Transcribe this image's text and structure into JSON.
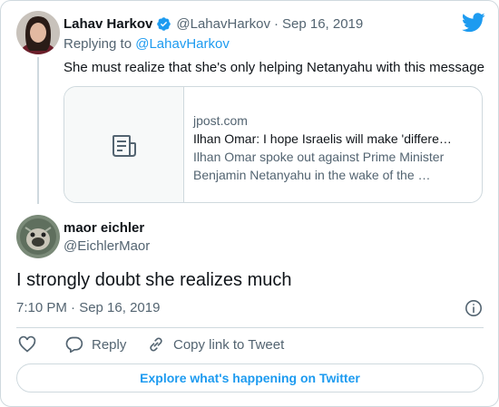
{
  "parent_tweet": {
    "author_name": "Lahav Harkov",
    "handle": "@LahavHarkov",
    "separator": "·",
    "date": "Sep 16, 2019",
    "replying_prefix": "Replying to",
    "replying_to": "@LahavHarkov",
    "text": "She must realize that she's only helping Netanyahu with this message",
    "verified_icon": "verified-badge-icon",
    "link_card": {
      "domain": "jpost.com",
      "title": "Ilhan Omar: I hope Israelis will make 'differe…",
      "description_line1": "Ilhan Omar spoke out against Prime Minister",
      "description_line2": "Benjamin Netanyahu in the wake of the …",
      "thumb_icon": "article-icon"
    }
  },
  "tweet": {
    "author_name": "maor eichler",
    "handle": "@EichlerMaor",
    "text": "I strongly doubt she realizes much",
    "timestamp": "7:10 PM · Sep 16, 2019",
    "info_icon": "info-icon"
  },
  "actions": {
    "like_icon": "heart-icon",
    "reply_label": "Reply",
    "copy_label": "Copy link to Tweet"
  },
  "explore_label": "Explore what's happening on Twitter",
  "colors": {
    "accent": "#1d9bf0",
    "text": "#0f1419",
    "muted": "#536471",
    "border": "#cfd9de"
  }
}
